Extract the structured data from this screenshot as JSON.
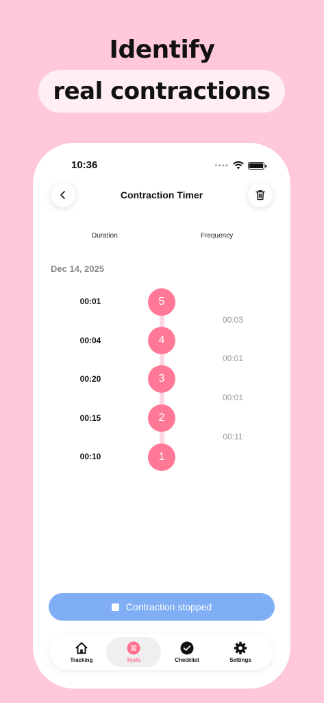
{
  "promo": {
    "line1": "Identify",
    "line2": "real contractions"
  },
  "status_bar": {
    "time": "10:36",
    "signal_dots": "••••"
  },
  "header": {
    "title": "Contraction Timer"
  },
  "columns": {
    "duration": "Duration",
    "frequency": "Frequency"
  },
  "date": "Dec 14, 2025",
  "contractions": [
    {
      "number": "5",
      "duration": "00:01"
    },
    {
      "number": "4",
      "duration": "00:04"
    },
    {
      "number": "3",
      "duration": "00:20"
    },
    {
      "number": "2",
      "duration": "00:15"
    },
    {
      "number": "1",
      "duration": "00:10"
    }
  ],
  "frequencies": [
    "00:03",
    "00:01",
    "00:01",
    "00:11"
  ],
  "stop_button": {
    "label": "Contraction stopped"
  },
  "tabs": [
    {
      "label": "Tracking",
      "icon": "home-icon",
      "active": false
    },
    {
      "label": "Tools",
      "icon": "command-icon",
      "active": true
    },
    {
      "label": "Checklist",
      "icon": "check-circle-icon",
      "active": false
    },
    {
      "label": "Settings",
      "icon": "gear-icon",
      "active": false
    }
  ],
  "colors": {
    "background": "#FFC8DC",
    "accent": "#FF7896",
    "button": "#7FAEF5"
  }
}
